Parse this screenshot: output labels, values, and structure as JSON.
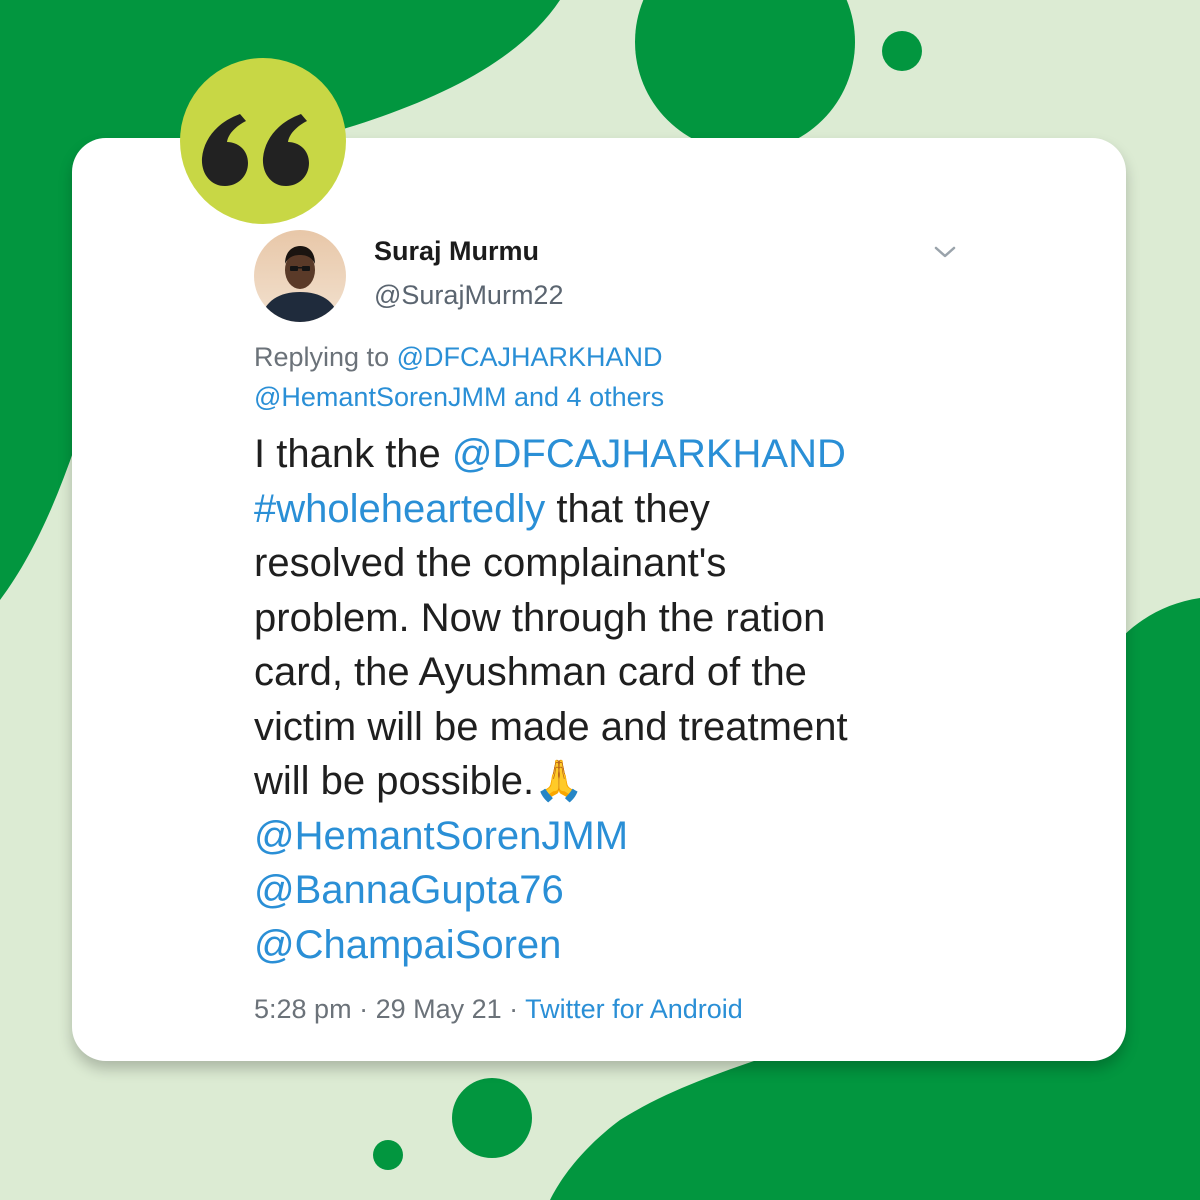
{
  "colors": {
    "brand_green": "#02963f",
    "pale_green": "#dcebd3",
    "quote_badge": "#c8d745",
    "link_blue": "#2a8fd6"
  },
  "icons": {
    "quote": "quote-icon",
    "menu": "chevron-down-icon"
  },
  "tweet": {
    "author_name": "Suraj Murmu",
    "author_handle": "@SurajMurm22",
    "replying_prefix": "Replying to ",
    "replying_handle": "@DFCAJHARKHAND",
    "replying_handle2": "@HemantSorenJMM",
    "replying_others": "and 4 others",
    "body": {
      "text1": "I thank the ",
      "mention1": "@DFCAJHARKHAND",
      "hashtag": "#wholeheartedly",
      "text2": " that they",
      "line3": "resolved the complainant's",
      "line4": "problem. Now through the ration",
      "line5": "card, the Ayushman card of the",
      "line6": "victim will be made and treatment",
      "line7": "will be possible.🙏",
      "mention2": "@HemantSorenJMM",
      "mention3": "@BannaGupta76",
      "mention4": "@ChampaiSoren"
    },
    "time": "5:28 pm",
    "separator": " · ",
    "date": "29 May 21",
    "client": "Twitter for Android"
  }
}
